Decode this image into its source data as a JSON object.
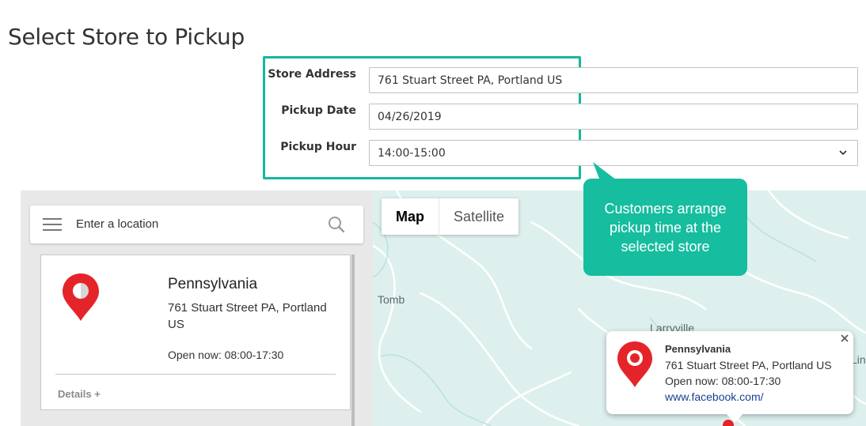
{
  "page": {
    "title": "Select Store to Pickup"
  },
  "form": {
    "store_address": {
      "label": "Store Address",
      "value": "761 Stuart Street PA, Portland US"
    },
    "pickup_date": {
      "label": "Pickup Date",
      "value": "04/26/2019"
    },
    "pickup_hour": {
      "label": "Pickup Hour",
      "value": "14:00-15:00"
    }
  },
  "callout": {
    "text": "Customers arrange pickup time at the selected store",
    "color": "#16bd9f"
  },
  "store_locator": {
    "search": {
      "placeholder": "Enter a location",
      "icon": "search-icon",
      "menu_icon": "hamburger-icon"
    },
    "store_card": {
      "name": "Pennsylvania",
      "address": "761 Stuart Street PA, Portland US",
      "hours": "Open now: 08:00-17:30",
      "details_label": "Details +",
      "pin_icon": "map-pin-icon"
    }
  },
  "map": {
    "tabs": [
      {
        "label": "Map",
        "active": true
      },
      {
        "label": "Satellite",
        "active": false
      }
    ],
    "place_labels": [
      "Tomb",
      "Larryville",
      "Lin"
    ],
    "info_window": {
      "name": "Pennsylvania",
      "address": "761 Stuart Street PA, Portland US",
      "hours": "Open now: 08:00-17:30",
      "link": "www.facebook.com/",
      "close_icon": "close-icon"
    }
  },
  "colors": {
    "accent": "#14b89b",
    "pin_red": "#e5242a",
    "map_water": "#ddf0ee"
  }
}
